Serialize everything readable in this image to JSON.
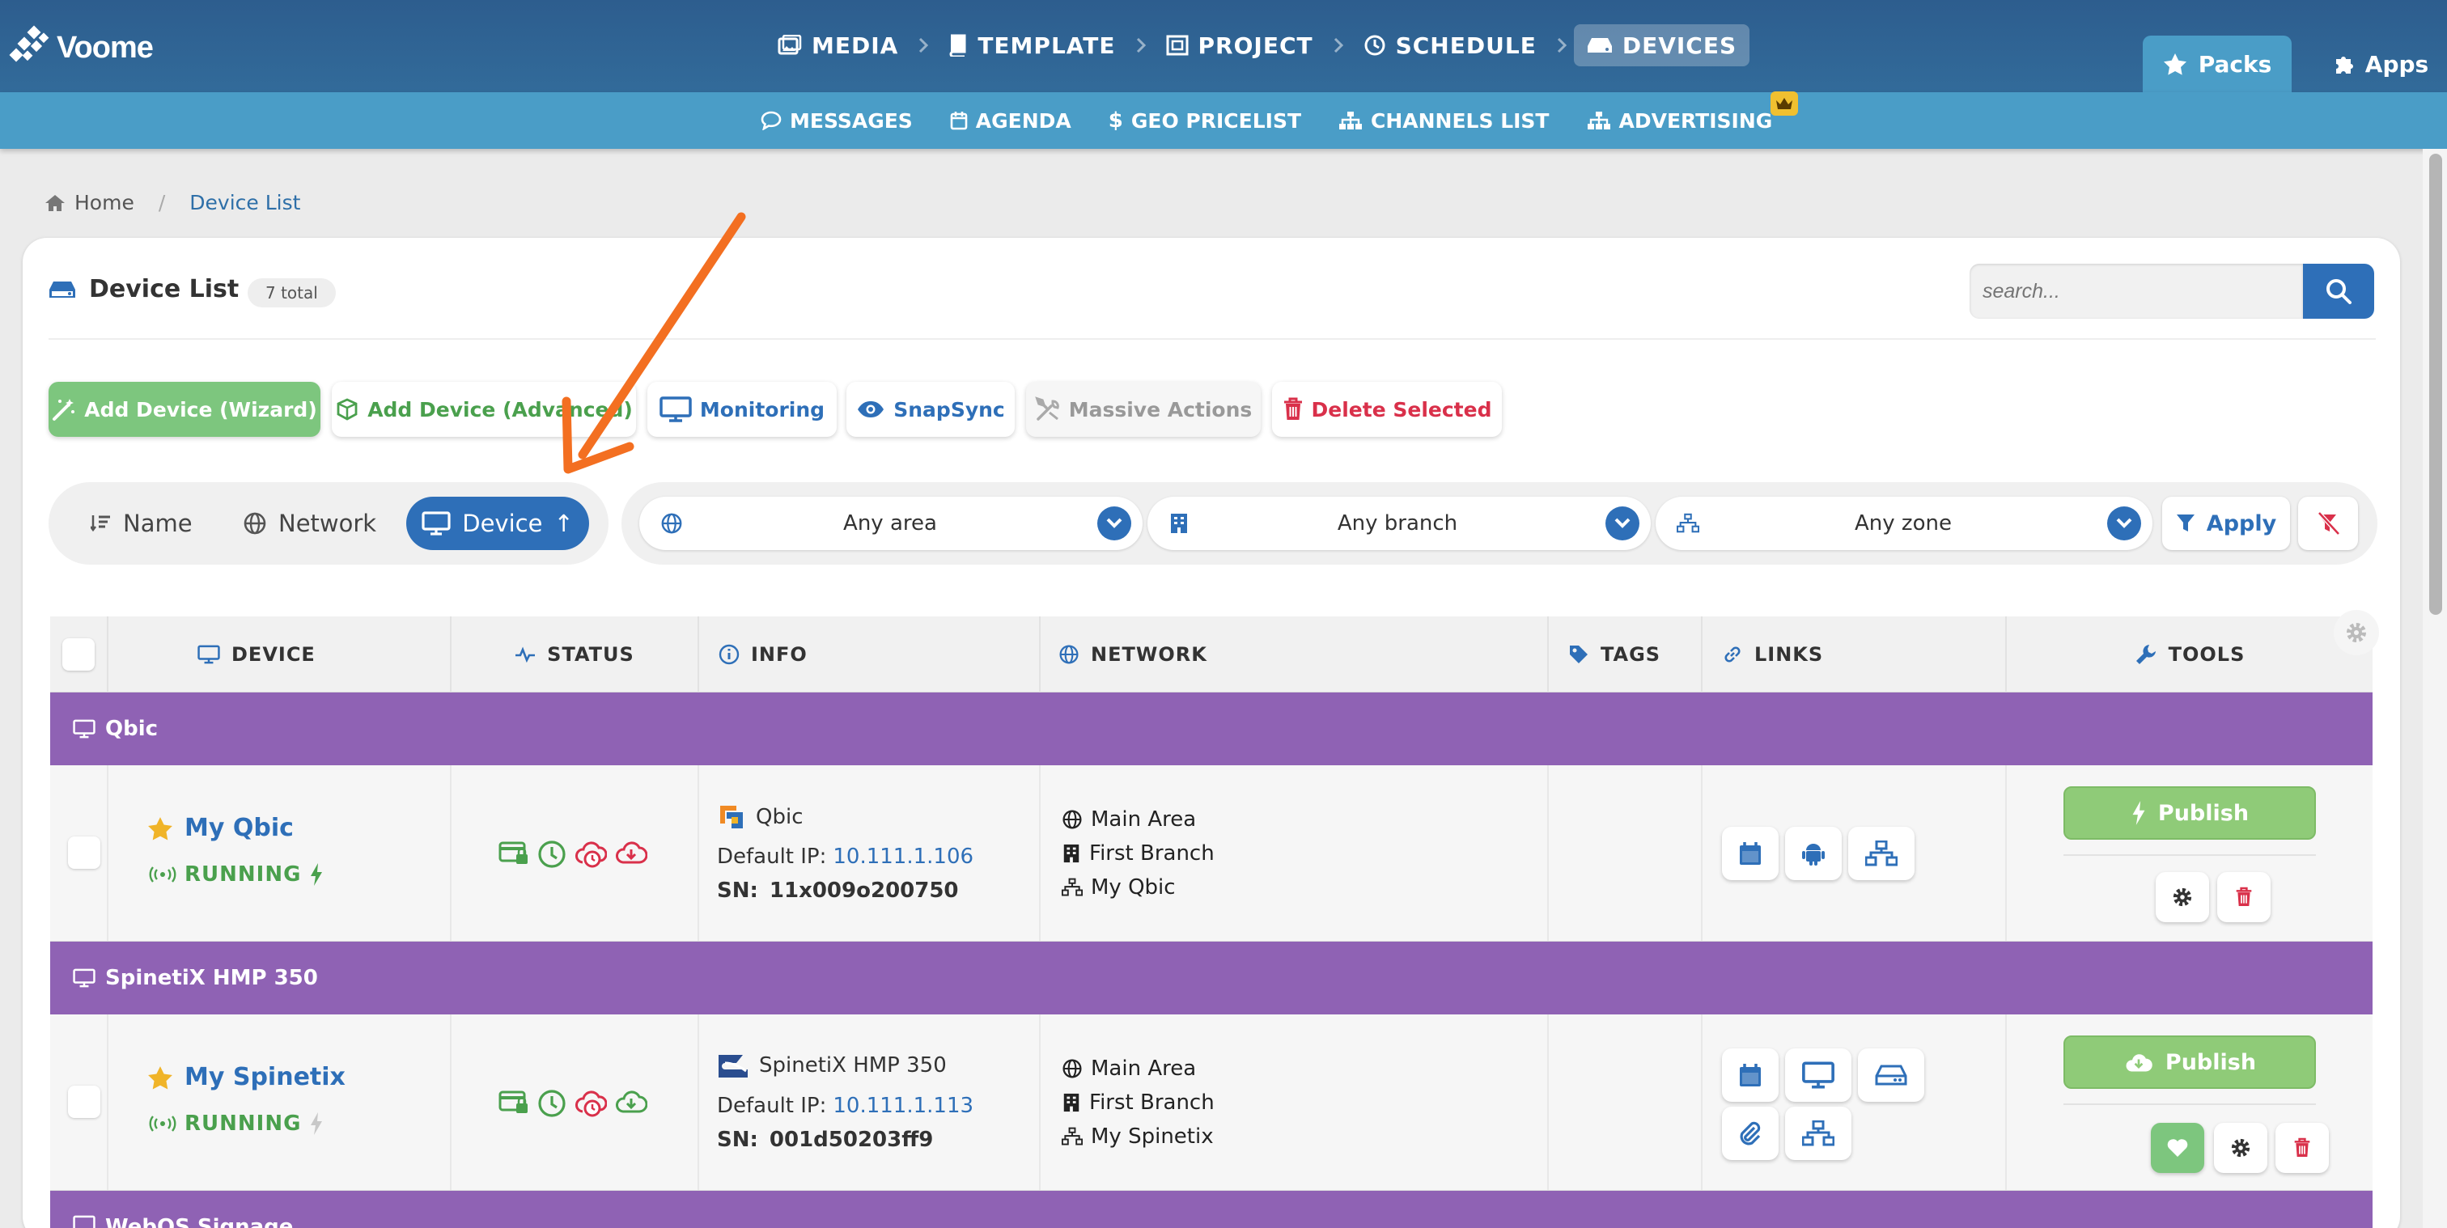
{
  "app": {
    "name": "Voome"
  },
  "main_nav": [
    {
      "label": "MEDIA",
      "icon": "image-icon"
    },
    {
      "label": "TEMPLATE",
      "icon": "book-icon"
    },
    {
      "label": "PROJECT",
      "icon": "project-icon"
    },
    {
      "label": "SCHEDULE",
      "icon": "clock-icon"
    },
    {
      "label": "DEVICES",
      "icon": "hdd-icon",
      "active": true
    }
  ],
  "top_tabs": {
    "packs": "Packs",
    "apps": "Apps"
  },
  "sub_nav": [
    {
      "label": "MESSAGES",
      "icon": "comment-icon"
    },
    {
      "label": "AGENDA",
      "icon": "calendar-icon"
    },
    {
      "label": "GEO PRICELIST",
      "icon": "dollar-icon"
    },
    {
      "label": "CHANNELS LIST",
      "icon": "sitemap-icon"
    },
    {
      "label": "ADVERTISING",
      "icon": "sitemap-icon",
      "badge": "crown-icon"
    }
  ],
  "breadcrumb": {
    "home": "Home",
    "current": "Device List"
  },
  "page": {
    "title": "Device List",
    "total": "7 total"
  },
  "search": {
    "placeholder": "search..."
  },
  "actions": {
    "add_wizard": "Add Device (Wizard)",
    "add_advanced": "Add Device (Advanced)",
    "monitoring": "Monitoring",
    "snapsync": "SnapSync",
    "massive": "Massive Actions",
    "delete_selected": "Delete Selected"
  },
  "sort": {
    "name": "Name",
    "network": "Network",
    "device": "Device",
    "device_arrow": "↑"
  },
  "filters": {
    "area": "Any area",
    "branch": "Any branch",
    "zone": "Any zone",
    "apply": "Apply"
  },
  "columns": {
    "device": "DEVICE",
    "status": "STATUS",
    "info": "INFO",
    "network": "NETWORK",
    "tags": "TAGS",
    "links": "LINKS",
    "tools": "TOOLS"
  },
  "groups": [
    {
      "label": "Qbic",
      "device": {
        "name": "My Qbic",
        "status": "RUNNING",
        "model": "Qbic",
        "ip_label": "Default IP:",
        "ip": "10.111.1.106",
        "sn_label": "SN:",
        "sn": "11x009o200750",
        "area": "Main Area",
        "branch": "First Branch",
        "zone": "My Qbic",
        "publish": "Publish"
      }
    },
    {
      "label": "SpinetiX HMP 350",
      "device": {
        "name": "My Spinetix",
        "status": "RUNNING",
        "model": "SpinetiX HMP 350",
        "ip_label": "Default IP:",
        "ip": "10.111.1.113",
        "sn_label": "SN:",
        "sn": "001d50203ff9",
        "area": "Main Area",
        "branch": "First Branch",
        "zone": "My Spinetix",
        "publish": "Publish"
      }
    },
    {
      "label": "WebOS Signage"
    }
  ],
  "colors": {
    "brand": "#2d5d8e",
    "accent": "#2e6fb8",
    "group": "#8f62b4",
    "running": "#4aa04d",
    "danger": "#d9304a",
    "annotation": "#f36f21"
  }
}
